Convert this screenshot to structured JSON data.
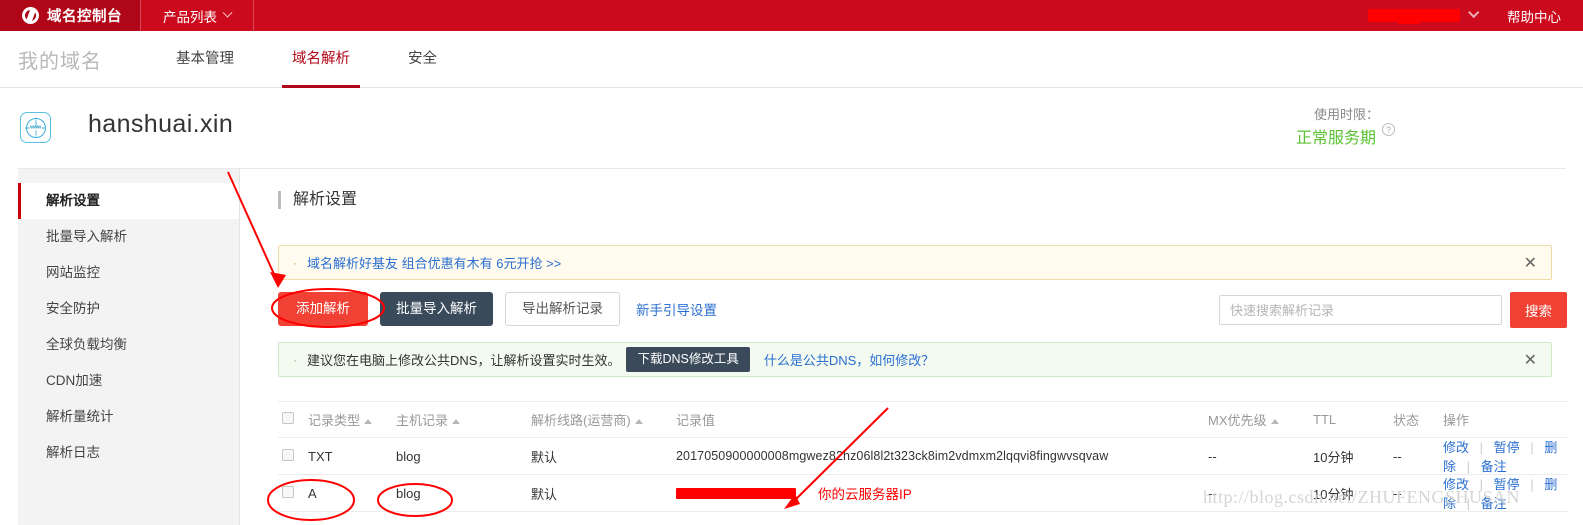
{
  "topbar": {
    "brand": "域名控制台",
    "product_list": "产品列表",
    "help_center": "帮助中心"
  },
  "nav": {
    "mydomain": "我的域名",
    "tabs": [
      {
        "label": "基本管理",
        "active": false
      },
      {
        "label": "域名解析",
        "active": true
      },
      {
        "label": "安全",
        "active": false
      }
    ]
  },
  "domain": {
    "name": "hanshuai.xin",
    "icon": "globe-www-icon",
    "usage_label": "使用时限：",
    "usage_value": "正常服务期",
    "usage_value_color": "#5bc236",
    "help_glyph": "?"
  },
  "sidebar": {
    "items": [
      {
        "label": "解析设置",
        "active": true
      },
      {
        "label": "批量导入解析",
        "active": false
      },
      {
        "label": "网站监控",
        "active": false
      },
      {
        "label": "安全防护",
        "active": false
      },
      {
        "label": "全球负载均衡",
        "active": false
      },
      {
        "label": "CDN加速",
        "active": false
      },
      {
        "label": "解析量统计",
        "active": false
      },
      {
        "label": "解析日志",
        "active": false
      }
    ]
  },
  "main": {
    "section_title": "解析设置",
    "notice_promo": {
      "bullet": "·",
      "text": "域名解析好基友 组合优惠有木有 6元开抢 >>",
      "close": "✕"
    },
    "notice_dns": {
      "bullet": "·",
      "text": "建议您在电脑上修改公共DNS，让解析设置实时生效。",
      "button": "下载DNS修改工具",
      "link": "什么是公共DNS，如何修改？",
      "close": "✕"
    },
    "toolbar": {
      "add": "添加解析",
      "batch_import": "批量导入解析",
      "export": "导出解析记录",
      "guide": "新手引导设置"
    },
    "search": {
      "placeholder": "快速搜索解析记录",
      "value": "",
      "button": "搜索"
    }
  },
  "table": {
    "headers": {
      "type": "记录类型",
      "host": "主机记录",
      "line": "解析线路(运营商)",
      "value": "记录值",
      "mx": "MX优先级",
      "ttl": "TTL",
      "state": "状态",
      "op": "操作"
    },
    "actions": {
      "edit": "修改",
      "pause": "暂停",
      "delete": "删除",
      "note": "备注",
      "sep": "|"
    },
    "rows": [
      {
        "type": "TXT",
        "host": "blog",
        "line": "默认",
        "value": "2017050900000008mgwez82hz06l8l2t323ck8im2vdmxm2lqqvi8fingwvsqvaw",
        "value_redacted": false,
        "mx": "--",
        "ttl": "10分钟",
        "state": "--"
      },
      {
        "type": "A",
        "host": "blog",
        "line": "默认",
        "value": "",
        "value_redacted": true,
        "mx": "--",
        "ttl": "10分钟",
        "state": "--"
      }
    ]
  },
  "annotations": {
    "server_ip_note": "你的云服务器IP",
    "note_color": "#ff0000"
  },
  "watermark": {
    "text": "http://blog.csdn.net/ZHUFENGSHUSAN"
  }
}
